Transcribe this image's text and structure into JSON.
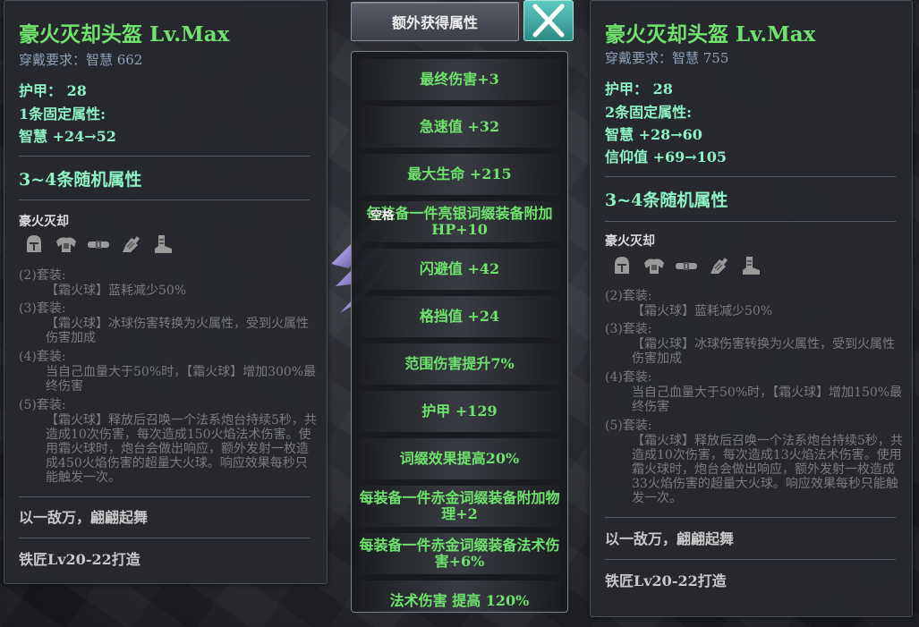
{
  "left_item": {
    "title": "豪火灭却头盔  Lv.Max",
    "requirement": "穿戴要求：智慧  662",
    "armor": "护甲：  28",
    "fixed_header": "1条固定属性:",
    "fixed_attrs": [
      "智慧  +24→52"
    ],
    "random_header": "3~4条随机属性",
    "set_name": "豪火灭却",
    "set_pieces": [
      "helmet-icon",
      "shoulder-icon",
      "belt-icon",
      "glove-icon",
      "boots-icon"
    ],
    "set_bonuses": [
      {
        "label": "(2)套装:",
        "desc": "【霜火球】蓝耗减少50%"
      },
      {
        "label": "(3)套装:",
        "desc": "【霜火球】冰球伤害转换为火属性，受到火属性伤害加成"
      },
      {
        "label": "(4)套装:",
        "desc": "当自己血量大于50%时，【霜火球】增加300%最终伤害"
      },
      {
        "label": "(5)套装:",
        "desc": "【霜火球】释放后召唤一个法系炮台持续5秒，共造成10次伤害，每次造成150火焰法术伤害。使用霜火球时，炮台会做出响应，额外发射一枚造成450火焰伤害的超量大火球。响应效果每秒只能触发一次。"
      }
    ],
    "flavor": "以一敌万，翩翩起舞",
    "craft": "铁匠Lv20-22打造"
  },
  "right_item": {
    "title": "豪火灭却头盔  Lv.Max",
    "requirement": "穿戴要求：智慧  755",
    "armor": "护甲：  28",
    "fixed_header": "2条固定属性:",
    "fixed_attrs": [
      "智慧  +28→60",
      "信仰值  +69→105"
    ],
    "random_header": "3~4条随机属性",
    "set_name": "豪火灭却",
    "set_pieces": [
      "helmet-icon",
      "shoulder-icon",
      "belt-icon",
      "glove-icon",
      "boots-icon"
    ],
    "set_bonuses": [
      {
        "label": "(2)套装:",
        "desc": "【霜火球】蓝耗减少50%"
      },
      {
        "label": "(3)套装:",
        "desc": "【霜火球】冰球伤害转换为火属性，受到火属性伤害加成"
      },
      {
        "label": "(4)套装:",
        "desc": "当自己血量大于50%时，【霜火球】增加150%最终伤害"
      },
      {
        "label": "(5)套装:",
        "desc": "【霜火球】释放后召唤一个法系炮台持续5秒，共造成10次伤害，每次造成13火焰法术伤害。使用霜火球时，炮台会做出响应，额外发射一枚造成33火焰伤害的超量大火球。响应效果每秒只能触发一次。"
      }
    ],
    "flavor": "以一敌万，翩翩起舞",
    "craft": "铁匠Lv20-22打造"
  },
  "extra_panel": {
    "tab_label": "额外获得属性",
    "close_icon": "close-icon",
    "attributes": [
      "最终伤害+3",
      "急速值  +32",
      "最大生命  +215",
      "每装备一件亮银词缀装备附加HP+10",
      "闪避值  +42",
      "格挡值  +24",
      "范围伤害提升7%",
      "护甲  +129",
      "词缀效果提高20%",
      "每装备一件赤金词缀装备附加物理+2",
      "每装备一件赤金词缀装备法术伤害+6%",
      "法术伤害  提高  120%"
    ]
  },
  "hint": "空格",
  "colors": {
    "title_green": "#6fe36d",
    "stat_cyan": "#8ef2c6",
    "muted_gray": "#7b7b7b",
    "close_teal": "#3fa9a3"
  }
}
